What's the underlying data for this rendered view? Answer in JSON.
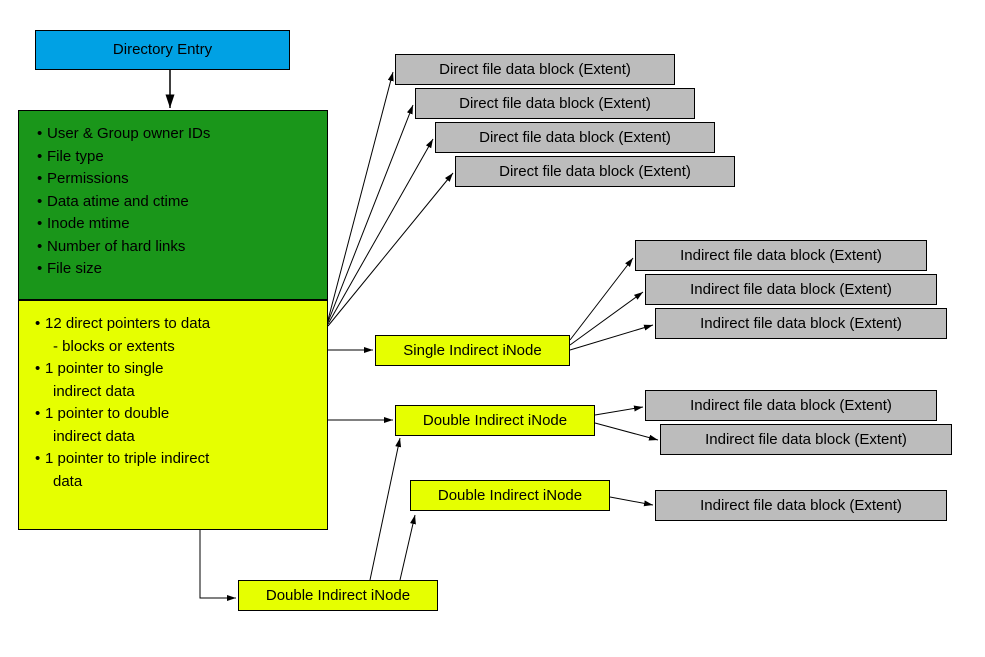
{
  "dirEntry": "Directory Entry",
  "metadata": [
    "User & Group owner IDs",
    "File type",
    "Permissions",
    "Data atime and ctime",
    "Inode mtime",
    "Number of hard links",
    "File size"
  ],
  "pointers": {
    "l1": "12 direct pointers to data",
    "l1b": "- blocks or extents",
    "l2": "1 pointer to single",
    "l2b": "indirect data",
    "l3": "1 pointer to double",
    "l3b": "indirect data",
    "l4": "1 pointer to triple indirect",
    "l4b": "data"
  },
  "directBlock": "Direct file data block (Extent)",
  "indirectBlock": "Indirect file data block (Extent)",
  "singleIndirect": "Single Indirect iNode",
  "doubleIndirect": "Double Indirect iNode"
}
